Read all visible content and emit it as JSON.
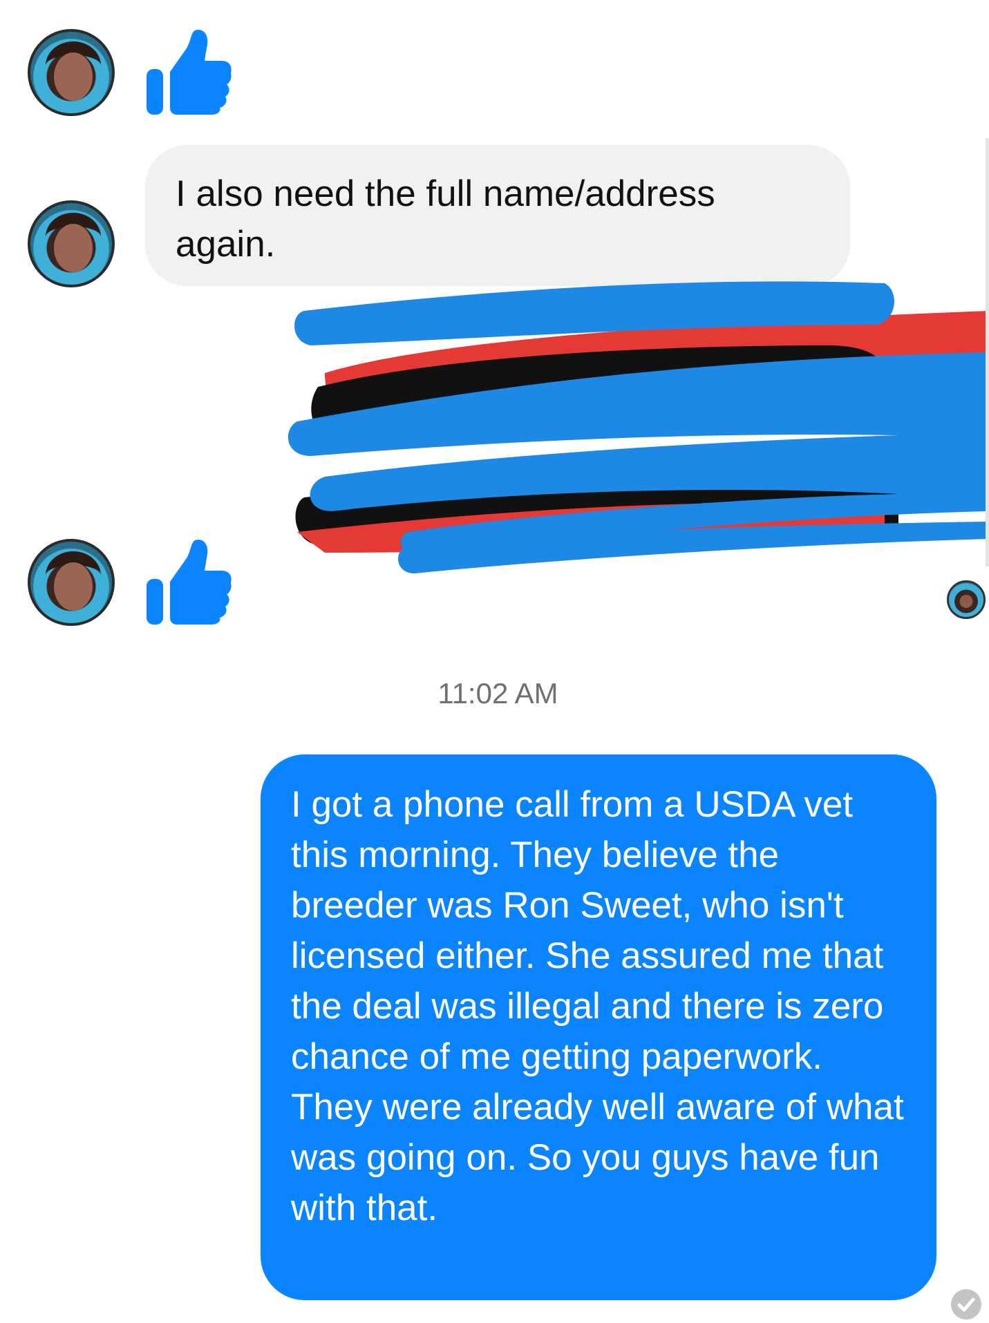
{
  "messages": [
    {
      "type": "received-like",
      "icon": "thumbs-up-icon"
    },
    {
      "type": "received",
      "text": "I also need the full name/address again."
    },
    {
      "type": "received-like",
      "icon": "thumbs-up-icon"
    },
    {
      "type": "sent",
      "text": "I got a phone call from a USDA vet this morning. They believe the breeder was Ron Sweet, who isn't licensed either. She assured me that the deal was illegal and there is zero chance of me getting paperwork. They were already well aware of what was going on. So you guys have fun with that."
    }
  ],
  "timestamp": "11:02 AM",
  "colors": {
    "sent_bubble": "#0a84ff",
    "received_bubble": "#f1f1f1",
    "like_icon": "#0a84ff",
    "redaction_blue": "#1e88e5",
    "redaction_red": "#e53935",
    "redaction_black": "#111111"
  }
}
